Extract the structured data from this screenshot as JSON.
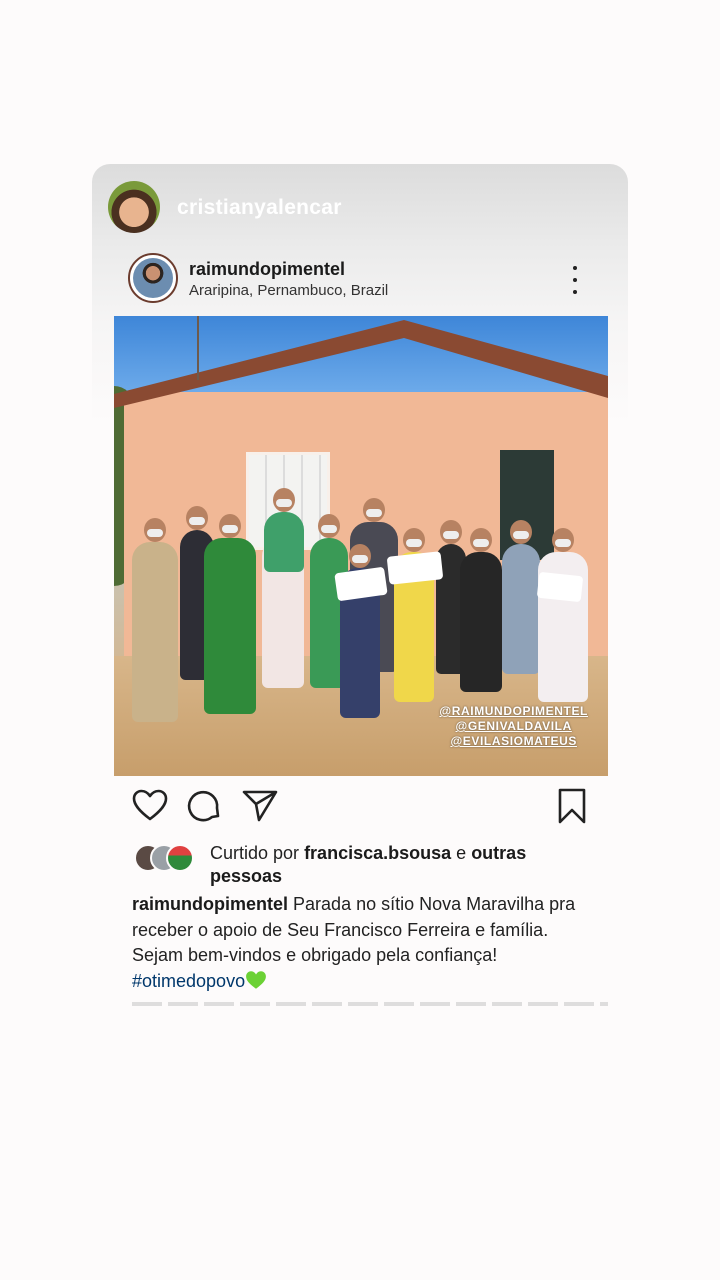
{
  "story": {
    "username": "cristianyalencar"
  },
  "post": {
    "username": "raimundopimentel",
    "location": "Araripina, Pernambuco, Brazil",
    "photo_tags": [
      "@RAIMUNDOPIMENTEL",
      "@GENIVALDAVILA",
      "@EVILASIOMATEUS"
    ],
    "likes": {
      "prefix": "Curtido por",
      "user": "francisca.bsousa",
      "connector": "e",
      "suffix": "outras pessoas"
    },
    "caption": {
      "username": "raimundopimentel",
      "text": "Parada no sítio Nova Maravilha pra receber o apoio de Seu Francisco Ferreira e família. Sejam bem-vindos e obrigado pela confiança!",
      "hashtag": "#otimedopovo"
    }
  },
  "icons": {
    "like": "heart-outline-icon",
    "comment": "speech-bubble-icon",
    "share": "paper-plane-icon",
    "save": "bookmark-icon",
    "more": "vertical-dots-icon",
    "emoji": "green-heart-emoji"
  },
  "colors": {
    "background": "#fdfbfb",
    "hashtag": "#00376b",
    "emoji_heart": "#6bd135"
  }
}
